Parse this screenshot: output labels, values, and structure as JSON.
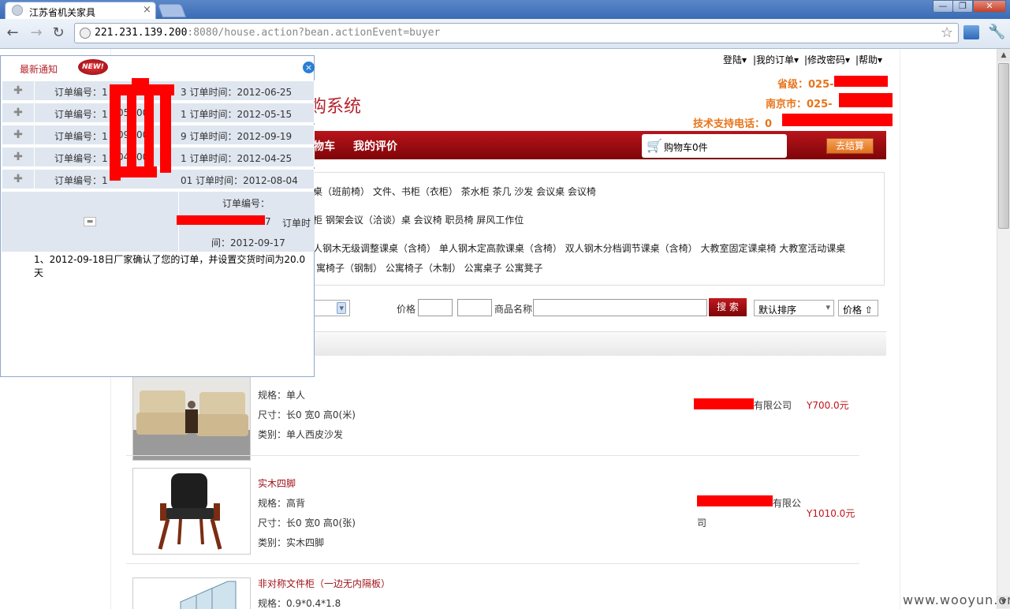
{
  "browser": {
    "tab_title": "江苏省机关家具",
    "tab_close": "×",
    "url_main": "221.231.139.200",
    "url_rest": ":8080/house.action?bean.actionEvent=buyer",
    "back": "←",
    "forward": "→",
    "reload": "↻",
    "star": "☆",
    "window_minimize": "—",
    "window_maximize": "❐",
    "window_close": "✕"
  },
  "header": {
    "nav": [
      "登陆▾",
      "|我的订单▾",
      "|修改密码▾",
      "|帮助▾"
    ],
    "site_title": "购系统",
    "contact": {
      "province": "省级：025-",
      "city": "南京市：025-",
      "support": "技术支持电话：0"
    }
  },
  "navbar": {
    "items": [
      "物车",
      "我的评价"
    ],
    "cart_label": "购物车0件",
    "checkout": "去结算"
  },
  "categories": {
    "line1": "桌（班前椅） 文件、书柜（衣柜） 茶水柜 茶几 沙发 会议桌 会议椅",
    "line2": "柜 钢架会议（洽谈）桌 会议椅 职员椅 屏风工作位",
    "line3": "人钢木无级调整课桌（含椅） 单人钢木定高款课桌（含椅） 双人钢木分档调节课桌（含椅） 大教室固定课桌椅 大教室活动课桌",
    "line4": "寓椅子（钢制） 公寓椅子（木制） 公寓桌子 公寓凳子"
  },
  "search": {
    "price_label": "价格",
    "name_label": "商品名称",
    "button": "搜 索",
    "sort_selected": "默认排序",
    "price_sort": "价格 ⇧"
  },
  "products": [
    {
      "name": "",
      "spec": "规格：单人",
      "size": "尺寸：长0 宽0 高0(米)",
      "category": "类别：单人西皮沙发",
      "company": "有限公司",
      "price": "Y700.0元"
    },
    {
      "name": "实木四脚",
      "spec": "规格：高背",
      "size": "尺寸：长0 宽0 高0(张)",
      "category": "类别：实木四脚",
      "company": "有限公",
      "company2": "司",
      "price": "Y1010.0元"
    },
    {
      "name": "非对称文件柜（一边无内隔板）",
      "spec": "规格：0.9*0.4*1.8"
    }
  ],
  "popup": {
    "title": "最新通知",
    "badge": "NEW!",
    "close": "×",
    "plus": "✚",
    "minus": "▬",
    "orders": [
      {
        "id": "订单编号：1",
        "time": "3  订单时间：2012-06-25"
      },
      {
        "id": "订单编号：1",
        "time": "1  订单时间：2012-05-15"
      },
      {
        "id": "订单编号：1",
        "time": "9  订单时间：2012-09-19"
      },
      {
        "id": "订单编号：1",
        "time": "1  订单时间：2012-04-25"
      },
      {
        "id": "订单编号：1",
        "time": "01 订单时间：2012-08-04"
      }
    ],
    "ids_mid": [
      "050",
      "003",
      "090",
      "003",
      "040",
      "003"
    ],
    "expanded": {
      "id_label": "订单编号：",
      "id_tail": "7",
      "time_label": "订单时",
      "time_value": "间：2012-09-17"
    },
    "note": "1、2012-09-18日厂家确认了您的订单，并设置交货时间为20.0天"
  },
  "watermark": "www.wooyun.org",
  "colors": {
    "brand_red": "#b5232b",
    "accent_orange": "#e8741a",
    "redaction": "#ff0000"
  }
}
